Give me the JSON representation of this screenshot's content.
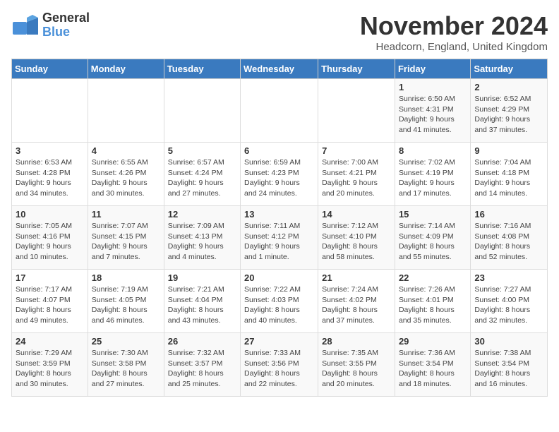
{
  "header": {
    "logo_line1": "General",
    "logo_line2": "Blue",
    "month": "November 2024",
    "location": "Headcorn, England, United Kingdom"
  },
  "weekdays": [
    "Sunday",
    "Monday",
    "Tuesday",
    "Wednesday",
    "Thursday",
    "Friday",
    "Saturday"
  ],
  "weeks": [
    [
      {
        "day": null,
        "info": null
      },
      {
        "day": null,
        "info": null
      },
      {
        "day": null,
        "info": null
      },
      {
        "day": null,
        "info": null
      },
      {
        "day": null,
        "info": null
      },
      {
        "day": "1",
        "info": "Sunrise: 6:50 AM\nSunset: 4:31 PM\nDaylight: 9 hours and 41 minutes."
      },
      {
        "day": "2",
        "info": "Sunrise: 6:52 AM\nSunset: 4:29 PM\nDaylight: 9 hours and 37 minutes."
      }
    ],
    [
      {
        "day": "3",
        "info": "Sunrise: 6:53 AM\nSunset: 4:28 PM\nDaylight: 9 hours and 34 minutes."
      },
      {
        "day": "4",
        "info": "Sunrise: 6:55 AM\nSunset: 4:26 PM\nDaylight: 9 hours and 30 minutes."
      },
      {
        "day": "5",
        "info": "Sunrise: 6:57 AM\nSunset: 4:24 PM\nDaylight: 9 hours and 27 minutes."
      },
      {
        "day": "6",
        "info": "Sunrise: 6:59 AM\nSunset: 4:23 PM\nDaylight: 9 hours and 24 minutes."
      },
      {
        "day": "7",
        "info": "Sunrise: 7:00 AM\nSunset: 4:21 PM\nDaylight: 9 hours and 20 minutes."
      },
      {
        "day": "8",
        "info": "Sunrise: 7:02 AM\nSunset: 4:19 PM\nDaylight: 9 hours and 17 minutes."
      },
      {
        "day": "9",
        "info": "Sunrise: 7:04 AM\nSunset: 4:18 PM\nDaylight: 9 hours and 14 minutes."
      }
    ],
    [
      {
        "day": "10",
        "info": "Sunrise: 7:05 AM\nSunset: 4:16 PM\nDaylight: 9 hours and 10 minutes."
      },
      {
        "day": "11",
        "info": "Sunrise: 7:07 AM\nSunset: 4:15 PM\nDaylight: 9 hours and 7 minutes."
      },
      {
        "day": "12",
        "info": "Sunrise: 7:09 AM\nSunset: 4:13 PM\nDaylight: 9 hours and 4 minutes."
      },
      {
        "day": "13",
        "info": "Sunrise: 7:11 AM\nSunset: 4:12 PM\nDaylight: 9 hours and 1 minute."
      },
      {
        "day": "14",
        "info": "Sunrise: 7:12 AM\nSunset: 4:10 PM\nDaylight: 8 hours and 58 minutes."
      },
      {
        "day": "15",
        "info": "Sunrise: 7:14 AM\nSunset: 4:09 PM\nDaylight: 8 hours and 55 minutes."
      },
      {
        "day": "16",
        "info": "Sunrise: 7:16 AM\nSunset: 4:08 PM\nDaylight: 8 hours and 52 minutes."
      }
    ],
    [
      {
        "day": "17",
        "info": "Sunrise: 7:17 AM\nSunset: 4:07 PM\nDaylight: 8 hours and 49 minutes."
      },
      {
        "day": "18",
        "info": "Sunrise: 7:19 AM\nSunset: 4:05 PM\nDaylight: 8 hours and 46 minutes."
      },
      {
        "day": "19",
        "info": "Sunrise: 7:21 AM\nSunset: 4:04 PM\nDaylight: 8 hours and 43 minutes."
      },
      {
        "day": "20",
        "info": "Sunrise: 7:22 AM\nSunset: 4:03 PM\nDaylight: 8 hours and 40 minutes."
      },
      {
        "day": "21",
        "info": "Sunrise: 7:24 AM\nSunset: 4:02 PM\nDaylight: 8 hours and 37 minutes."
      },
      {
        "day": "22",
        "info": "Sunrise: 7:26 AM\nSunset: 4:01 PM\nDaylight: 8 hours and 35 minutes."
      },
      {
        "day": "23",
        "info": "Sunrise: 7:27 AM\nSunset: 4:00 PM\nDaylight: 8 hours and 32 minutes."
      }
    ],
    [
      {
        "day": "24",
        "info": "Sunrise: 7:29 AM\nSunset: 3:59 PM\nDaylight: 8 hours and 30 minutes."
      },
      {
        "day": "25",
        "info": "Sunrise: 7:30 AM\nSunset: 3:58 PM\nDaylight: 8 hours and 27 minutes."
      },
      {
        "day": "26",
        "info": "Sunrise: 7:32 AM\nSunset: 3:57 PM\nDaylight: 8 hours and 25 minutes."
      },
      {
        "day": "27",
        "info": "Sunrise: 7:33 AM\nSunset: 3:56 PM\nDaylight: 8 hours and 22 minutes."
      },
      {
        "day": "28",
        "info": "Sunrise: 7:35 AM\nSunset: 3:55 PM\nDaylight: 8 hours and 20 minutes."
      },
      {
        "day": "29",
        "info": "Sunrise: 7:36 AM\nSunset: 3:54 PM\nDaylight: 8 hours and 18 minutes."
      },
      {
        "day": "30",
        "info": "Sunrise: 7:38 AM\nSunset: 3:54 PM\nDaylight: 8 hours and 16 minutes."
      }
    ]
  ]
}
